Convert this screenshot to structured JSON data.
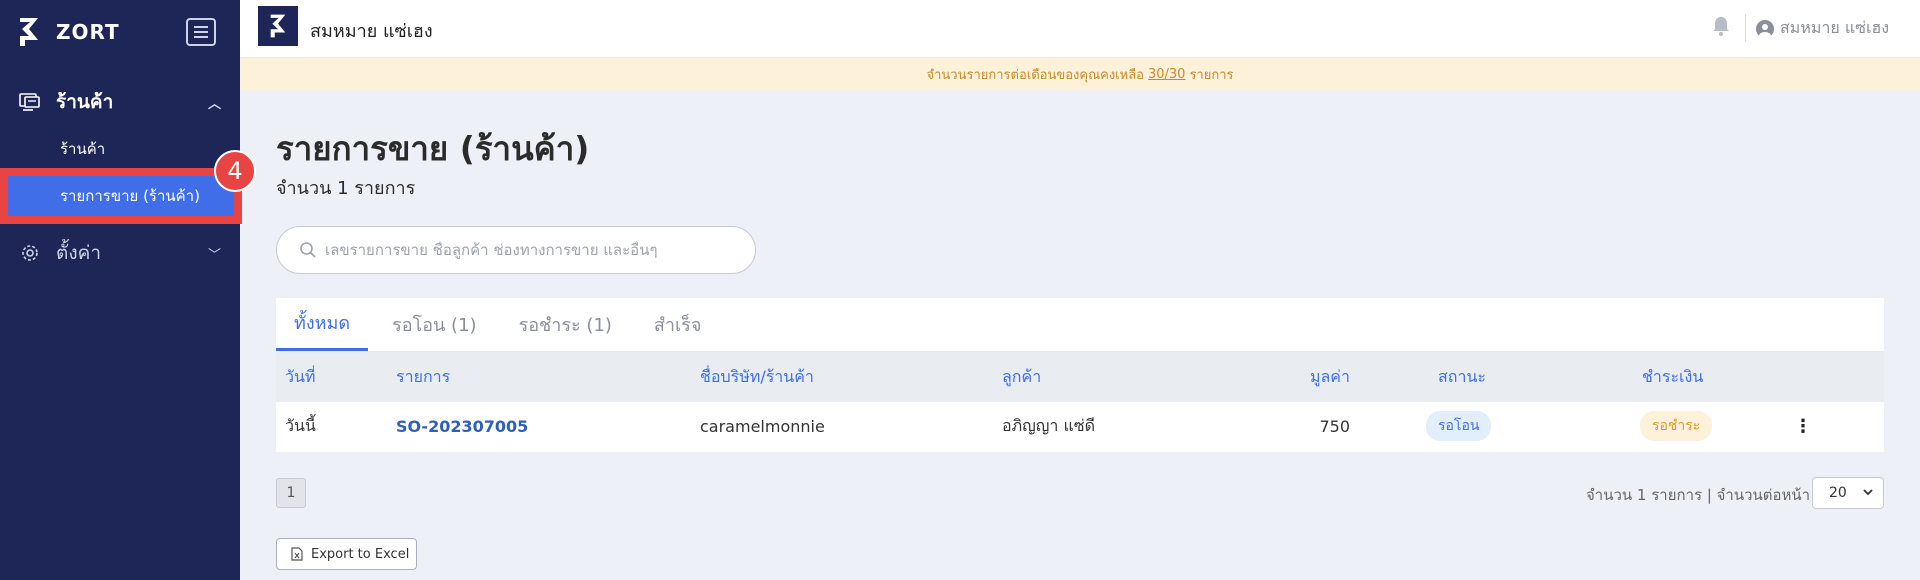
{
  "sidebar": {
    "brand": "ZORT",
    "nav_store": "ร้านค้า",
    "sub_store": "ร้านค้า",
    "sub_sales": "รายการขาย (ร้านค้า)",
    "nav_settings": "ตั้งค่า",
    "step_number": "4"
  },
  "topbar": {
    "shop_name": "สมหมาย แซ่เฮง",
    "user_name": "สมหมาย แซ่เฮง"
  },
  "notice": {
    "prefix": "จำนวนรายการต่อเดือนของคุณคงเหลือ",
    "quota": "30/30",
    "suffix": "รายการ"
  },
  "main": {
    "title": "รายการขาย (ร้านค้า)",
    "count": "จำนวน 1 รายการ",
    "search_placeholder": "เลขรายการขาย ชื่อลูกค้า ช่องทางการขาย และอื่นๆ"
  },
  "tabs": [
    "ทั้งหมด",
    "รอโอน (1)",
    "รอชำระ (1)",
    "สำเร็จ"
  ],
  "table": {
    "headers": {
      "date": "วันที่",
      "order": "รายการ",
      "shop": "ชื่อบริษัท/ร้านค้า",
      "customer": "ลูกค้า",
      "value": "มูลค่า",
      "status": "สถานะ",
      "payment": "ชำระเงิน"
    },
    "rows": [
      {
        "date": "วันนี้",
        "order": "SO-202307005",
        "shop": "caramelmonnie",
        "customer": "อภิญญา แซ่ดี",
        "value": "750",
        "status": "รอโอน",
        "payment": "รอชำระ"
      }
    ]
  },
  "pagination": {
    "page": "1",
    "summary": "จำนวน 1 รายการ | จำนวนต่อหน้า",
    "per_page": "20"
  },
  "export_label": "Export to Excel",
  "colors": {
    "sidebar_bg": "#1e2557",
    "accent": "#3f6ee8",
    "highlight": "#e94444",
    "notice_text": "#c98a29"
  }
}
